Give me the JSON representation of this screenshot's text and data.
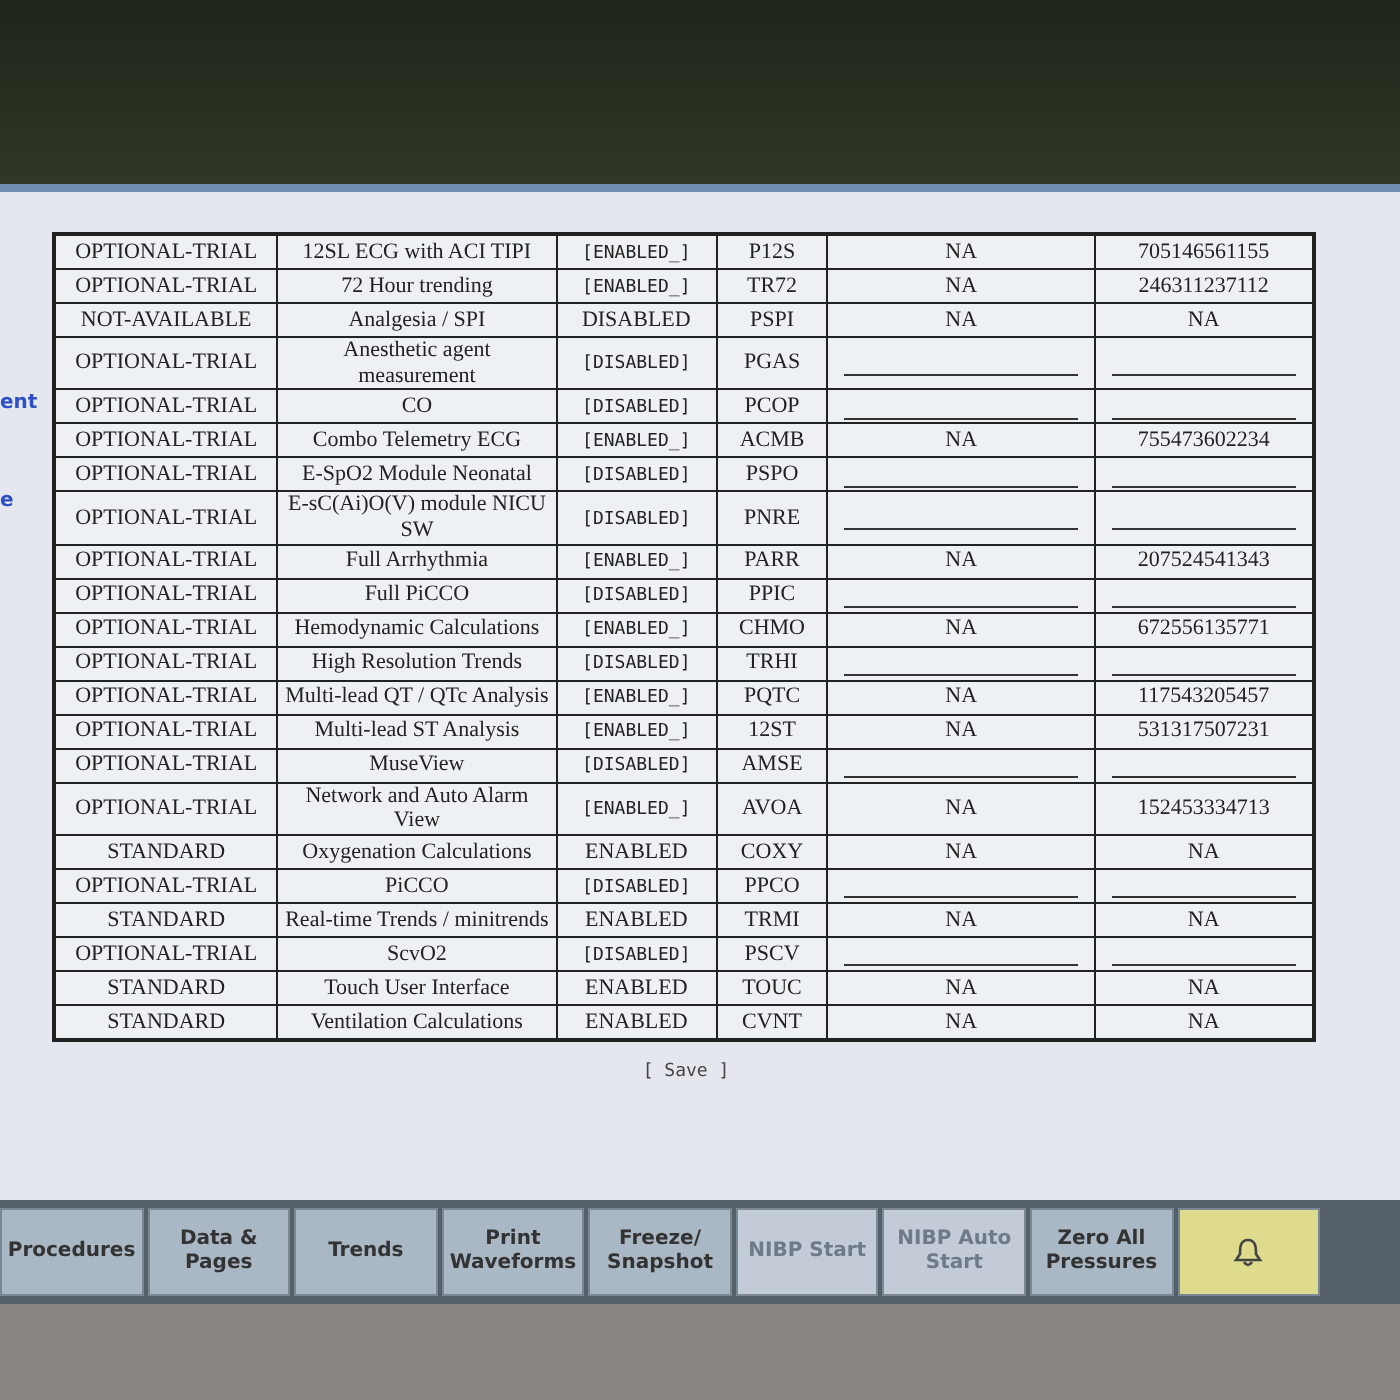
{
  "side_fragments": [
    "ent",
    "e"
  ],
  "rows": [
    {
      "license": "OPTIONAL-TRIAL",
      "name": "12SL ECG with ACI TIPI",
      "status": "[ENABLED_]",
      "code": "P12S",
      "kind": "value",
      "col5": "NA",
      "col6": "705146561155"
    },
    {
      "license": "OPTIONAL-TRIAL",
      "name": "72 Hour trending",
      "status": "[ENABLED_]",
      "code": "TR72",
      "kind": "value",
      "col5": "NA",
      "col6": "246311237112"
    },
    {
      "license": "NOT-AVAILABLE",
      "name": "Analgesia / SPI",
      "status": "DISABLED",
      "code": "PSPI",
      "kind": "value",
      "col5": "NA",
      "col6": "NA"
    },
    {
      "license": "OPTIONAL-TRIAL",
      "name": "Anesthetic agent measurement",
      "status": "[DISABLED]",
      "code": "PGAS",
      "kind": "blank"
    },
    {
      "license": "OPTIONAL-TRIAL",
      "name": "CO",
      "status": "[DISABLED]",
      "code": "PCOP",
      "kind": "blank"
    },
    {
      "license": "OPTIONAL-TRIAL",
      "name": "Combo Telemetry ECG",
      "status": "[ENABLED_]",
      "code": "ACMB",
      "kind": "value",
      "col5": "NA",
      "col6": "755473602234"
    },
    {
      "license": "OPTIONAL-TRIAL",
      "name": "E-SpO2 Module Neonatal",
      "status": "[DISABLED]",
      "code": "PSPO",
      "kind": "blank"
    },
    {
      "license": "OPTIONAL-TRIAL",
      "name": "E-sC(Ai)O(V) module NICU SW",
      "status": "[DISABLED]",
      "code": "PNRE",
      "kind": "blank"
    },
    {
      "license": "OPTIONAL-TRIAL",
      "name": "Full Arrhythmia",
      "status": "[ENABLED_]",
      "code": "PARR",
      "kind": "value",
      "col5": "NA",
      "col6": "207524541343"
    },
    {
      "license": "OPTIONAL-TRIAL",
      "name": "Full PiCCO",
      "status": "[DISABLED]",
      "code": "PPIC",
      "kind": "blank"
    },
    {
      "license": "OPTIONAL-TRIAL",
      "name": "Hemodynamic Calculations",
      "status": "[ENABLED_]",
      "code": "CHMO",
      "kind": "value",
      "col5": "NA",
      "col6": "672556135771"
    },
    {
      "license": "OPTIONAL-TRIAL",
      "name": "High Resolution Trends",
      "status": "[DISABLED]",
      "code": "TRHI",
      "kind": "blank"
    },
    {
      "license": "OPTIONAL-TRIAL",
      "name": "Multi-lead QT / QTc Analysis",
      "status": "[ENABLED_]",
      "code": "PQTC",
      "kind": "value",
      "col5": "NA",
      "col6": "117543205457"
    },
    {
      "license": "OPTIONAL-TRIAL",
      "name": "Multi-lead ST Analysis",
      "status": "[ENABLED_]",
      "code": "12ST",
      "kind": "value",
      "col5": "NA",
      "col6": "531317507231"
    },
    {
      "license": "OPTIONAL-TRIAL",
      "name": "MuseView",
      "status": "[DISABLED]",
      "code": "AMSE",
      "kind": "blank"
    },
    {
      "license": "OPTIONAL-TRIAL",
      "name": "Network and Auto Alarm View",
      "status": "[ENABLED_]",
      "code": "AVOA",
      "kind": "value",
      "col5": "NA",
      "col6": "152453334713"
    },
    {
      "license": "STANDARD",
      "name": "Oxygenation Calculations",
      "status": "ENABLED",
      "code": "COXY",
      "kind": "value",
      "col5": "NA",
      "col6": "NA"
    },
    {
      "license": "OPTIONAL-TRIAL",
      "name": "PiCCO",
      "status": "[DISABLED]",
      "code": "PPCO",
      "kind": "blank"
    },
    {
      "license": "STANDARD",
      "name": "Real-time Trends / minitrends",
      "status": "ENABLED",
      "code": "TRMI",
      "kind": "value",
      "col5": "NA",
      "col6": "NA"
    },
    {
      "license": "OPTIONAL-TRIAL",
      "name": "ScvO2",
      "status": "[DISABLED]",
      "code": "PSCV",
      "kind": "blank"
    },
    {
      "license": "STANDARD",
      "name": "Touch User Interface",
      "status": "ENABLED",
      "code": "TOUC",
      "kind": "value",
      "col5": "NA",
      "col6": "NA"
    },
    {
      "license": "STANDARD",
      "name": "Ventilation Calculations",
      "status": "ENABLED",
      "code": "CVNT",
      "kind": "value",
      "col5": "NA",
      "col6": "NA"
    }
  ],
  "save_button": "[ Save ]",
  "bottom_bar": [
    {
      "label": "Procedures",
      "disabled": false,
      "kind": "text"
    },
    {
      "label": "Data & Pages",
      "disabled": false,
      "kind": "text"
    },
    {
      "label": "Trends",
      "disabled": false,
      "kind": "text"
    },
    {
      "label": "Print Waveforms",
      "disabled": false,
      "kind": "text"
    },
    {
      "label": "Freeze/ Snapshot",
      "disabled": false,
      "kind": "text"
    },
    {
      "label": "NIBP Start",
      "disabled": true,
      "kind": "text"
    },
    {
      "label": "NIBP Auto Start",
      "disabled": true,
      "kind": "text"
    },
    {
      "label": "Zero All Pressures",
      "disabled": false,
      "kind": "text"
    },
    {
      "kind": "alarm"
    }
  ]
}
